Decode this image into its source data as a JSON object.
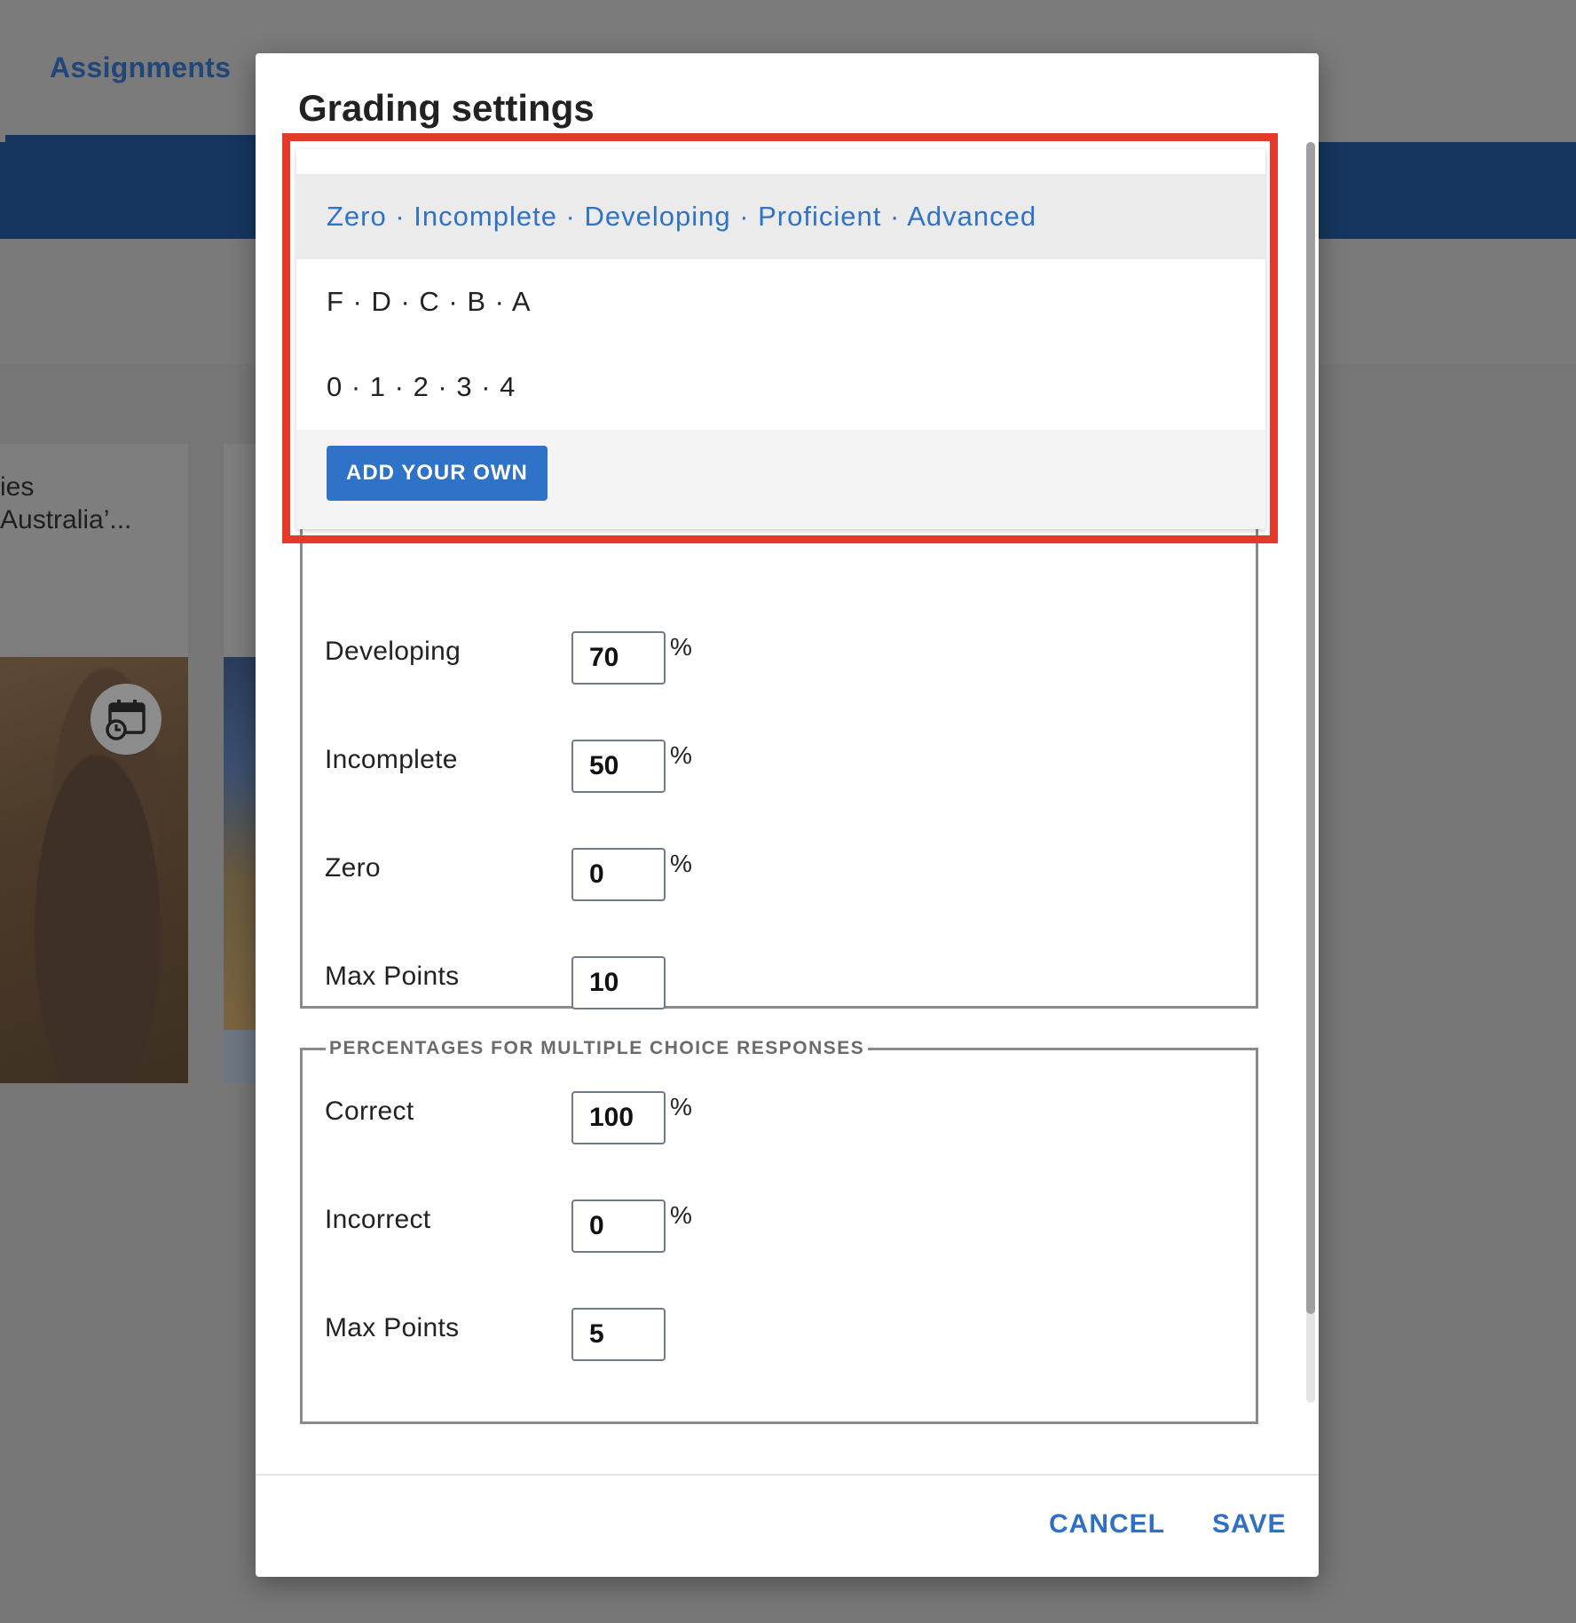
{
  "background": {
    "tab_label": "Assignments",
    "card_title": "ies\nAustralia’..."
  },
  "dialog": {
    "title": "Grading settings",
    "cancel_label": "CANCEL",
    "save_label": "SAVE"
  },
  "grading_scale_dropdown": {
    "options": [
      "Zero · Incomplete · Developing · Proficient · Advanced",
      "F · D · C · B · A",
      "0 · 1 · 2 · 3 · 4"
    ],
    "selected_index": 0,
    "add_own_label": "ADD YOUR OWN"
  },
  "scale_section": {
    "rows": [
      {
        "label": "Developing",
        "value": "70",
        "suffix": "%"
      },
      {
        "label": "Incomplete",
        "value": "50",
        "suffix": "%"
      },
      {
        "label": "Zero",
        "value": "0",
        "suffix": "%"
      },
      {
        "label": "Max Points",
        "value": "10",
        "suffix": ""
      }
    ]
  },
  "multiple_choice_section": {
    "legend": "PERCENTAGES FOR MULTIPLE CHOICE RESPONSES",
    "rows": [
      {
        "label": "Correct",
        "value": "100",
        "suffix": "%"
      },
      {
        "label": "Incorrect",
        "value": "0",
        "suffix": "%"
      },
      {
        "label": "Max Points",
        "value": "5",
        "suffix": ""
      }
    ]
  },
  "colors": {
    "accent": "#2f73c9",
    "highlight_outline": "#e53a2a"
  },
  "icons": [
    "calendar-clock-icon"
  ]
}
